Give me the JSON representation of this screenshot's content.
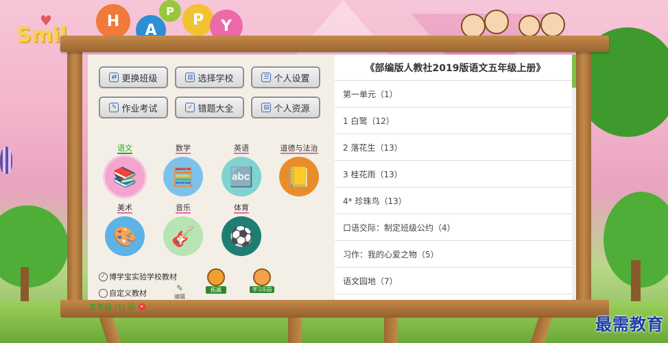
{
  "logo_text": "Smil",
  "balloons": [
    "H",
    "A",
    "P",
    "P",
    "Y"
  ],
  "buttons": [
    {
      "label": "更换班级",
      "icon": "switch-class-icon",
      "glyph": "⇄"
    },
    {
      "label": "选择学校",
      "icon": "school-icon",
      "glyph": "▥"
    },
    {
      "label": "个人设置",
      "icon": "profile-card-icon",
      "glyph": "☰"
    },
    {
      "label": "作业考试",
      "icon": "homework-icon",
      "glyph": "✎"
    },
    {
      "label": "错题大全",
      "icon": "wrong-questions-icon",
      "glyph": "✓"
    },
    {
      "label": "个人资源",
      "icon": "resource-icon",
      "glyph": "▤"
    }
  ],
  "subjects": [
    {
      "label": "语文",
      "icon": "books-icon",
      "glyph": "📚",
      "color": "#f5a4d0",
      "active": true
    },
    {
      "label": "数学",
      "icon": "abacus-icon",
      "glyph": "🧮",
      "color": "#7cc3ec",
      "active": false
    },
    {
      "label": "英语",
      "icon": "abc-blocks-icon",
      "glyph": "🔤",
      "color": "#7fd3d0",
      "active": false
    },
    {
      "label": "道德与法治",
      "icon": "notebook-icon",
      "glyph": "📒",
      "color": "#e98d2b",
      "active": false
    },
    {
      "label": "美术",
      "icon": "palette-icon",
      "glyph": "🎨",
      "color": "#5db3e6",
      "active": false
    },
    {
      "label": "音乐",
      "icon": "guitar-icon",
      "glyph": "🎸",
      "color": "#b7e3b5",
      "active": false
    },
    {
      "label": "体育",
      "icon": "sports-icon",
      "glyph": "⚽",
      "color": "#1e7e74",
      "active": false
    }
  ],
  "materials": {
    "option1": "博学宝实验学校教材",
    "option2": "自定义教材",
    "edit_label": "编辑",
    "expand_label": "拓展",
    "paradise_label": "学习乐园"
  },
  "book": {
    "title": "《部编版人教社2019版语文五年级上册》",
    "units": [
      "第一单元（1）",
      "1 白鹭（12）",
      "2 落花生（13）",
      "3 桂花雨（13）",
      "4* 珍珠鸟（13）",
      "口语交际：制定班级公约（4）",
      "习作：我的心爱之物（5）",
      "语文园地（7）"
    ]
  },
  "status": {
    "grade": "五年级",
    "term": "(1)",
    "class": "班"
  },
  "watermark": "最需教育",
  "colors": {
    "accent_green": "#2ca52c",
    "underline_pink": "#e26aa8",
    "wood": "#b07a3d"
  }
}
